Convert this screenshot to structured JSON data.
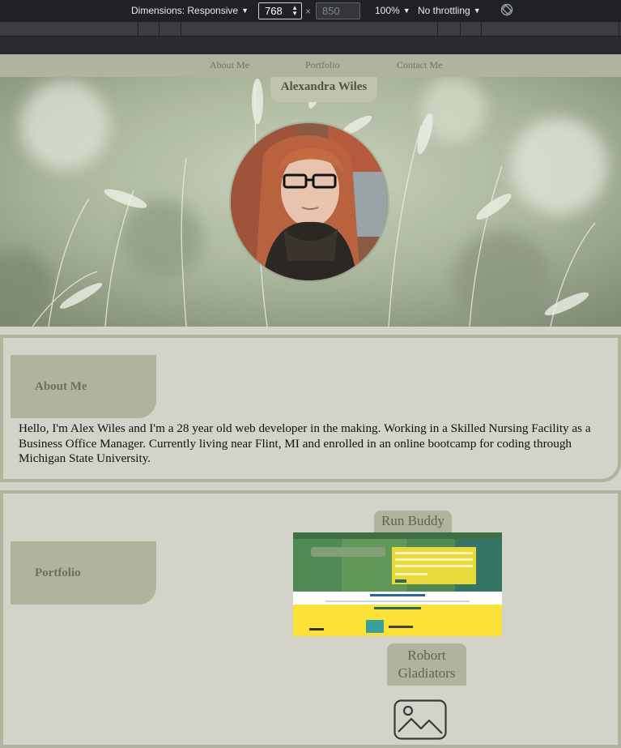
{
  "devtools": {
    "dimensions_label": "Dimensions: Responsive",
    "width_value": "768",
    "times": "×",
    "height_placeholder": "850",
    "zoom": "100%",
    "throttling": "No throttling"
  },
  "nav": {
    "items": [
      {
        "label": "About Me"
      },
      {
        "label": "Portfolio"
      },
      {
        "label": "Contact Me"
      }
    ]
  },
  "hero": {
    "name": "Alexandra Wiles"
  },
  "about": {
    "heading": "About Me",
    "text": "Hello, I'm Alex Wiles and I'm a 28 year old web developer in the making. Working in a Skilled Nursing Facility as a Business Office Manager. Currently living near Flint, MI and enrolled in an online bootcamp for coding through Michigan State University."
  },
  "portfolio": {
    "heading": "Portfolio",
    "projects": [
      {
        "title": "Run Buddy"
      },
      {
        "title": "Robort Gladiators"
      }
    ]
  },
  "colors": {
    "page_bg": "#d3d3c9",
    "accent": "#b0b49f",
    "tab_text": "#6d715c"
  }
}
